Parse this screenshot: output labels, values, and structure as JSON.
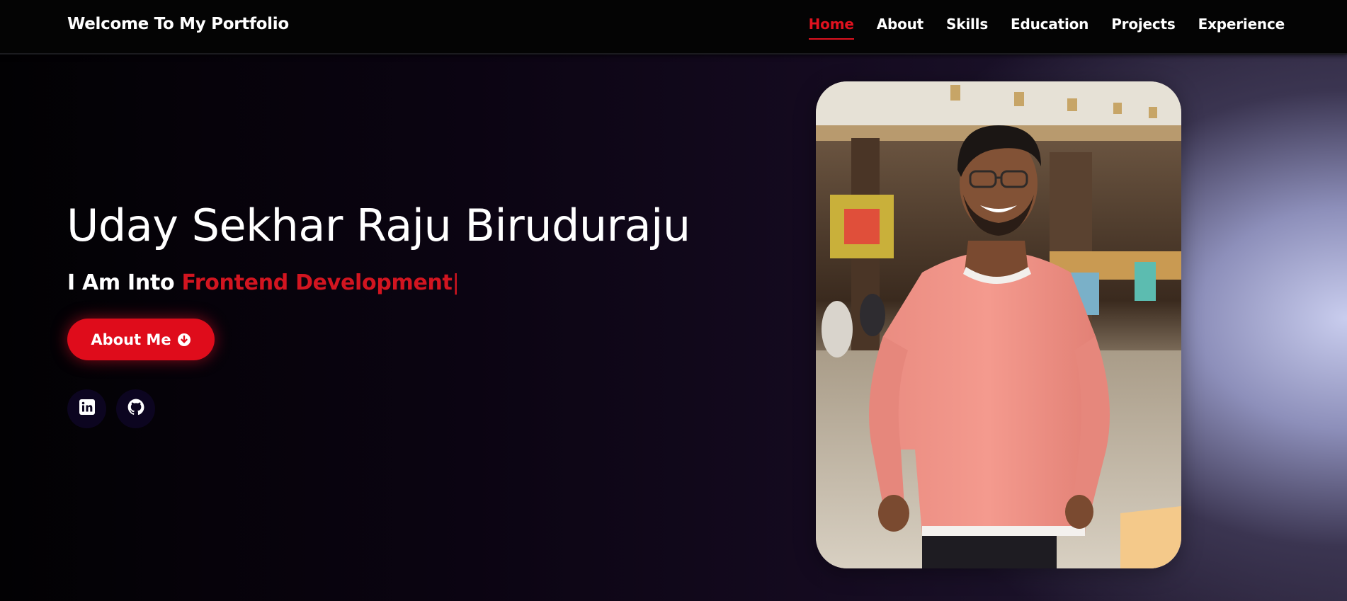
{
  "header": {
    "brand": "Welcome To My Portfolio",
    "nav": [
      {
        "label": "Home",
        "active": true
      },
      {
        "label": "About",
        "active": false
      },
      {
        "label": "Skills",
        "active": false
      },
      {
        "label": "Education",
        "active": false
      },
      {
        "label": "Projects",
        "active": false
      },
      {
        "label": "Experience",
        "active": false
      }
    ]
  },
  "hero": {
    "name": "Uday Sekhar Raju Biruduraju",
    "subtitle_prefix": "I Am Into",
    "subtitle_typed": "Frontend Development",
    "caret": "|",
    "about_button_label": "About Me",
    "about_button_icon": "arrow-circle-down-icon",
    "socials": [
      {
        "icon": "linkedin-icon"
      },
      {
        "icon": "github-icon"
      }
    ]
  },
  "colors": {
    "accent": "#df0c1b",
    "header_bg": "#040404",
    "text": "#ffffff",
    "social_bg": "#0c0520"
  }
}
